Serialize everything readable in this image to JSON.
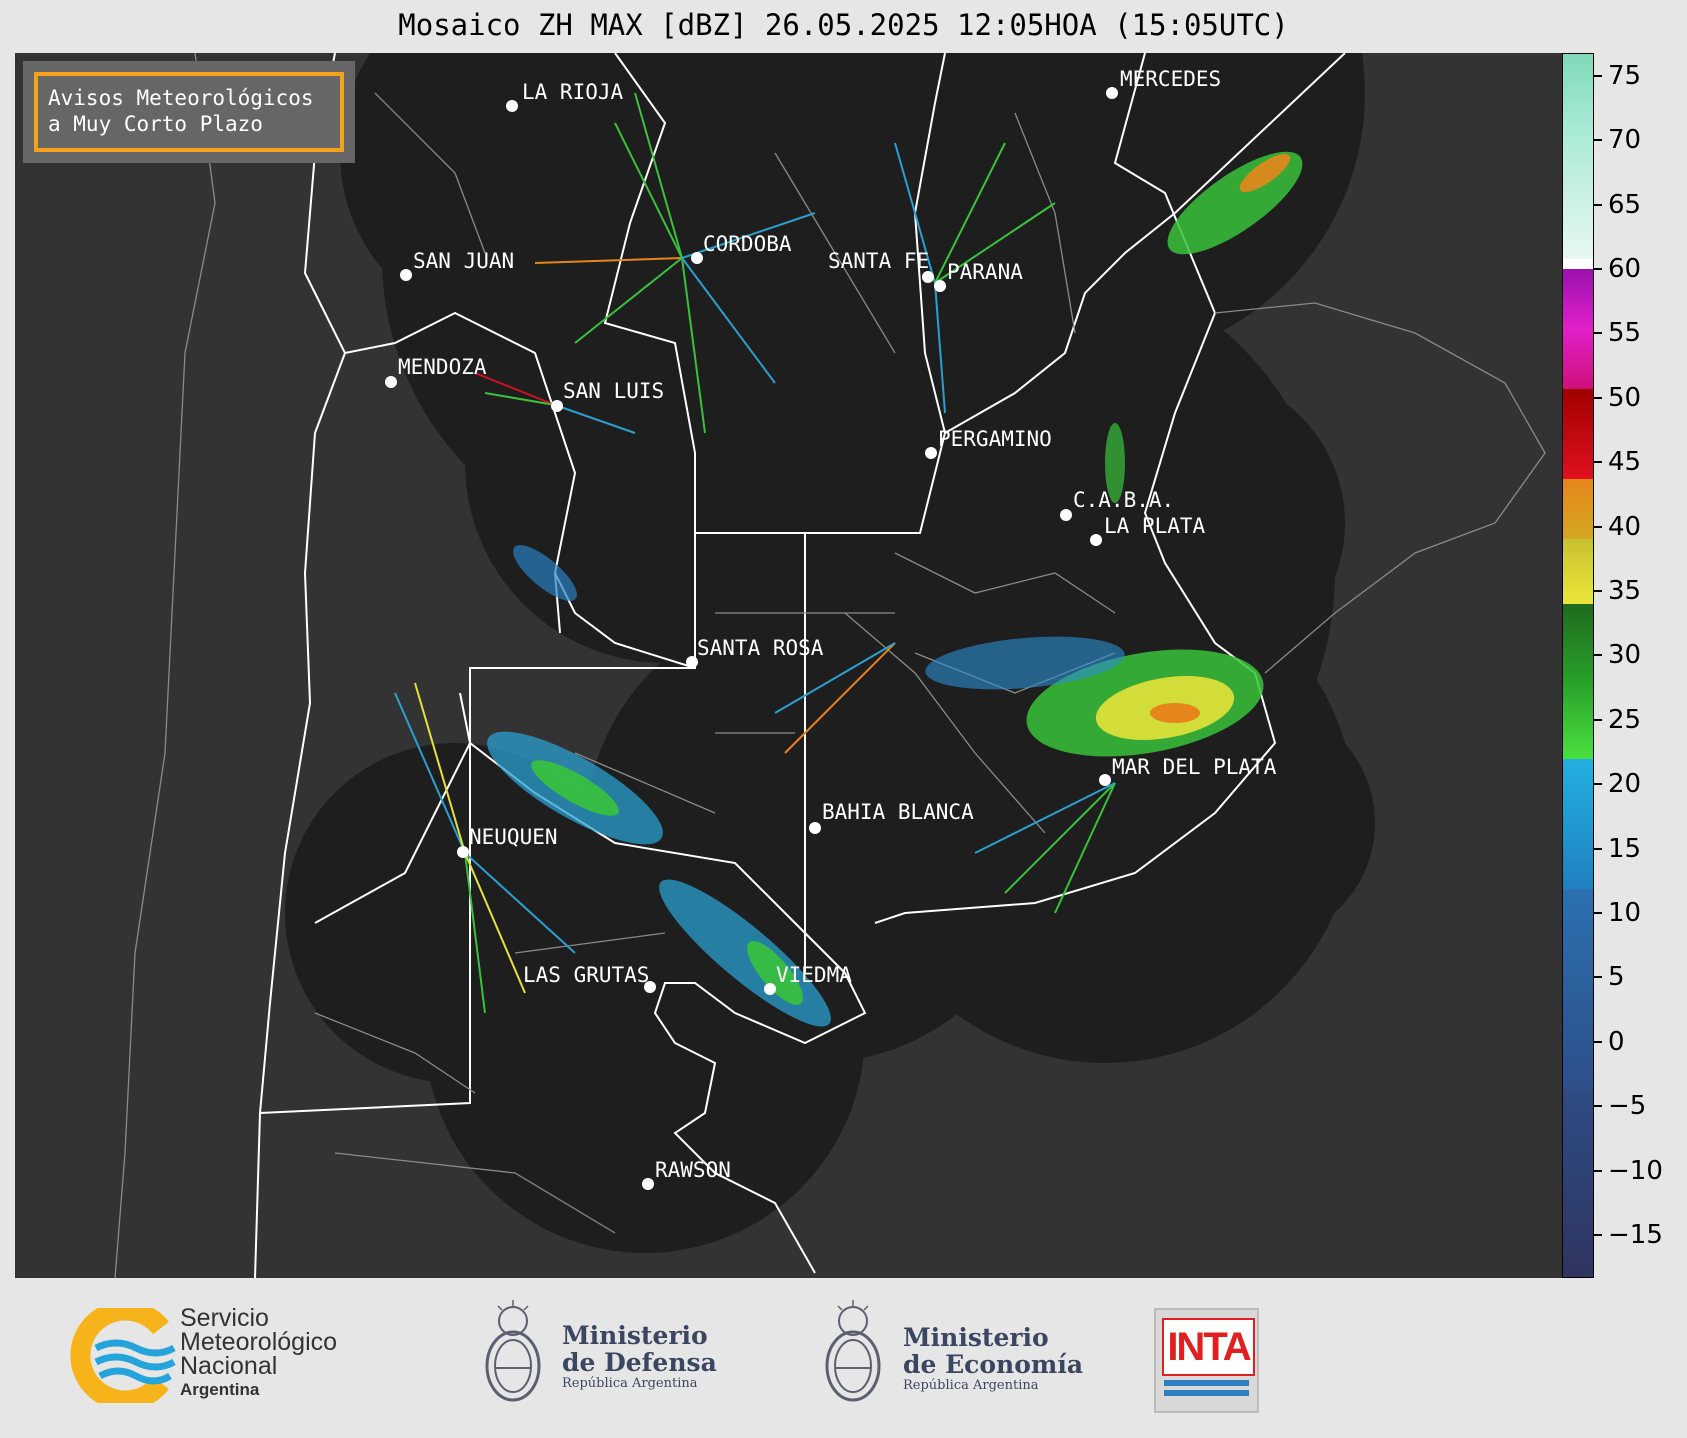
{
  "title": "Mosaico ZH MAX [dBZ] 26.05.2025 12:05HOA (15:05UTC)",
  "avisos": {
    "line1": "Avisos Meteorológicos",
    "line2": "a Muy Corto Plazo"
  },
  "cities": [
    {
      "name": "LA RIOJA"
    },
    {
      "name": "CORDOBA"
    },
    {
      "name": "SAN JUAN"
    },
    {
      "name": "SANTA FE"
    },
    {
      "name": "PARANA"
    },
    {
      "name": "MERCEDES"
    },
    {
      "name": "MENDOZA"
    },
    {
      "name": "SAN LUIS"
    },
    {
      "name": "PERGAMINO"
    },
    {
      "name": "C.A.B.A."
    },
    {
      "name": "LA PLATA"
    },
    {
      "name": "SANTA ROSA"
    },
    {
      "name": "MAR DEL PLATA"
    },
    {
      "name": "BAHIA BLANCA"
    },
    {
      "name": "NEUQUEN"
    },
    {
      "name": "LAS GRUTAS"
    },
    {
      "name": "VIEDMA"
    },
    {
      "name": "RAWSON"
    }
  ],
  "colorbar": {
    "unit": "dBZ",
    "ticks": [
      "75",
      "70",
      "65",
      "60",
      "55",
      "50",
      "45",
      "40",
      "35",
      "30",
      "25",
      "20",
      "15",
      "10",
      "5",
      "0",
      "−5",
      "−10",
      "−15"
    ],
    "colors": {
      "range_-20_to_-15": "#2f3460",
      "range_0_to_5": "#2b5fa0",
      "range_15_to_20": "#22a8d8",
      "range_20_to_30": "#39c23a",
      "range_30_to_40": "#e4e23a",
      "range_40_to_45": "#e6861a",
      "range_45_to_50": "#d01025",
      "range_55_to_60": "#c020c8",
      "range_60_to_75": "#8fe0c8"
    }
  },
  "logos": {
    "smn": {
      "line1": "Servicio",
      "line2": "Meteorológico",
      "line3": "Nacional",
      "line4": "Argentina"
    },
    "defensa": {
      "line1": "Ministerio",
      "line2": "de Defensa",
      "line3": "República Argentina"
    },
    "economia": {
      "line1": "Ministerio",
      "line2": "de Economía",
      "line3": "República Argentina"
    },
    "inta": {
      "label": "INTA"
    }
  }
}
